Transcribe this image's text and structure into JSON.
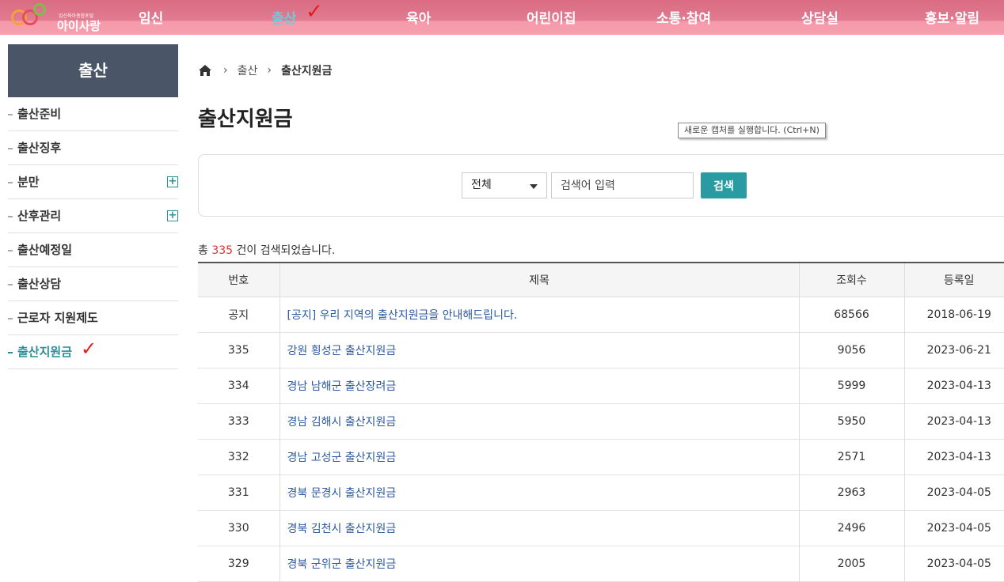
{
  "header": {
    "logo_tagline": "임신육아종합포털",
    "logo_name": "아이사랑",
    "menu": [
      {
        "label": "임신"
      },
      {
        "label": "출산"
      },
      {
        "label": "육아"
      },
      {
        "label": "어린이집"
      },
      {
        "label": "소통·참여"
      },
      {
        "label": "상담실"
      },
      {
        "label": "홍보·알림"
      }
    ],
    "check": "✓"
  },
  "sidebar": {
    "title": "출산",
    "items": [
      {
        "label": "출산준비"
      },
      {
        "label": "출산징후"
      },
      {
        "label": "분만",
        "expand": "+"
      },
      {
        "label": "산후관리",
        "expand": "+"
      },
      {
        "label": "출산예정일"
      },
      {
        "label": "출산상담"
      },
      {
        "label": "근로자 지원제도"
      },
      {
        "label": "출산지원금"
      }
    ]
  },
  "breadcrumb": {
    "items": [
      "출산",
      "출산지원금"
    ],
    "separator": "›"
  },
  "page_title": "출산지원금",
  "tooltip": "새로운 캡처를 실행합니다. (Ctrl+N)",
  "search": {
    "category": "전체",
    "placeholder": "검색어 입력",
    "button": "검색"
  },
  "results": {
    "prefix": "총 ",
    "count": "335",
    "suffix": " 건이 검색되었습니다."
  },
  "table": {
    "headers": [
      "번호",
      "제목",
      "조회수",
      "등록일"
    ],
    "rows": [
      {
        "no": "공지",
        "title": "[공지] 우리 지역의 출산지원금을 안내해드립니다.",
        "views": "68566",
        "date": "2018-06-19"
      },
      {
        "no": "335",
        "title": "강원 횡성군 출산지원금",
        "views": "9056",
        "date": "2023-06-21"
      },
      {
        "no": "334",
        "title": "경남 남해군 출산장려금",
        "views": "5999",
        "date": "2023-04-13"
      },
      {
        "no": "333",
        "title": "경남 김해시 출산지원금",
        "views": "5950",
        "date": "2023-04-13"
      },
      {
        "no": "332",
        "title": "경남 고성군 출산지원금",
        "views": "2571",
        "date": "2023-04-13"
      },
      {
        "no": "331",
        "title": "경북 문경시 출산지원금",
        "views": "2963",
        "date": "2023-04-05"
      },
      {
        "no": "330",
        "title": "경북 김천시 출산지원금",
        "views": "2496",
        "date": "2023-04-05"
      },
      {
        "no": "329",
        "title": "경북 군위군 출산지원금",
        "views": "2005",
        "date": "2023-04-05"
      }
    ]
  },
  "colors": {
    "accent": "#2a9aa3",
    "nav": "#e17c92",
    "link": "#2c5aa0",
    "sidebar_title": "#4a5568"
  }
}
